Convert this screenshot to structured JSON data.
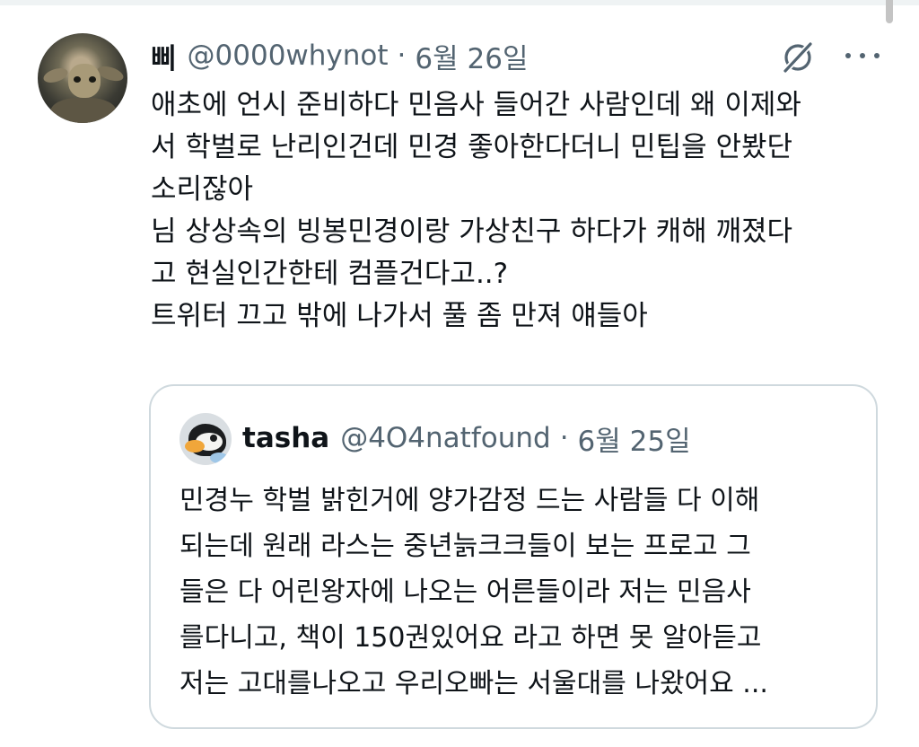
{
  "tweet": {
    "display_name": "삐",
    "handle": "@0000whynot",
    "separator": "·",
    "date": "6월 26일",
    "lines": [
      "애초에 언시 준비하다 민음사 들어간 사람인데 왜 이제와",
      "서 학벌로 난리인건데 민경 좋아한다더니 민팁을 안봤단",
      "소리잖아",
      "님 상상속의 빙봉민경이랑 가상친구 하다가 캐해 깨졌다",
      "고 현실인간한테 컴플건다고..?",
      "트위터 끄고 밖에 나가서 풀 좀 만져 얘들아"
    ]
  },
  "quote": {
    "display_name": "tasha",
    "handle": "@4O4natfound",
    "separator": "·",
    "date": "6월 25일",
    "lines": [
      "민경누 학벌 밝힌거에 양가감정 드는 사람들 다 이해",
      "되는데 원래 라스는 중년늙크크들이 보는 프로고 그",
      "들은 다 어린왕자에 나오는 어른들이라 저는 민음사",
      "를다니고, 책이 150권있어요 라고 하면 못 알아듣고",
      "저는 고대를나오고 우리오빠는 서울대를 나왔어요 ..."
    ]
  },
  "icons": {
    "grok": "grok-icon",
    "more": "more-icon"
  },
  "colors": {
    "text": "#0f1419",
    "secondary": "#536471",
    "border": "#cfd9de"
  }
}
